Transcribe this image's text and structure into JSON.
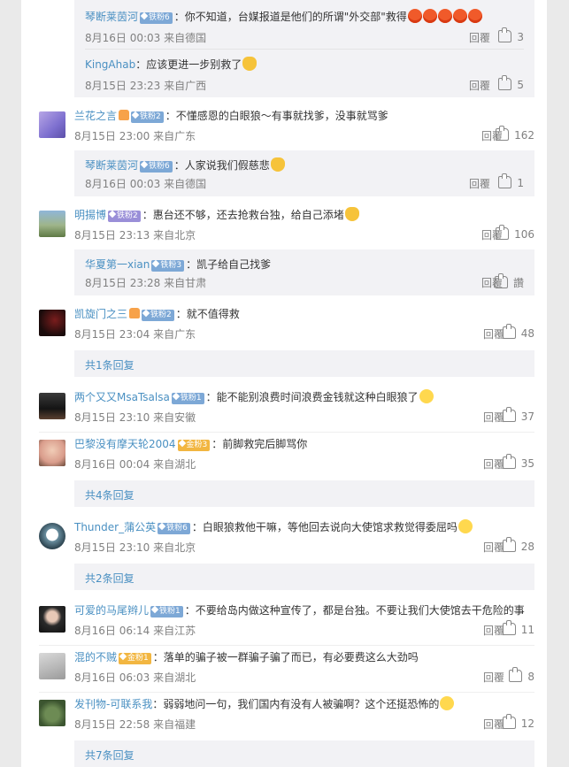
{
  "ui": {
    "reply": "回覆",
    "reply_simple": "回复"
  },
  "c0": {
    "replies": [
      {
        "user": "琴断莱茵河",
        "badge": "铁粉6",
        "text": "：你不知道，台媒报道是他们的所谓\"外交部\"救得",
        "emoji": "angry",
        "meta": "8月16日 00:03 来自德国",
        "reply": "回覆",
        "likes": "3"
      },
      {
        "user": "KingAhab",
        "badge": "",
        "text": "：应该更进一步别救了",
        "emoji": "cat",
        "meta": "8月15日 23:23 来自广西",
        "reply": "回覆",
        "likes": "5"
      }
    ]
  },
  "c1": {
    "user": "兰花之言",
    "badge": "铁粉2",
    "text": "：不懂感恩的白眼狼～有事就找爹，没事就骂爹",
    "meta": "8月15日 23:00 来自广东",
    "reply": "回覆",
    "likes": "162",
    "replies": [
      {
        "user": "琴断莱茵河",
        "badge": "铁粉6",
        "text": "：人家说我们假慈悲",
        "emoji": "cat",
        "meta": "8月16日 00:03 来自德国",
        "reply": "回覆",
        "likes": "1"
      }
    ]
  },
  "c2": {
    "user": "明揚博",
    "badge": "铁粉2",
    "text": "：惠台还不够，还去抢救台独，给自己添堵",
    "meta": "8月15日 23:13 来自北京",
    "reply": "回覆",
    "likes": "106",
    "replies": [
      {
        "user": "华夏第一xian",
        "badge": "铁粉3",
        "text": "：凯子给自己找爹",
        "meta": "8月15日 23:28 来自甘肃",
        "reply": "回覆",
        "likes": "讚"
      }
    ]
  },
  "c3": {
    "user": "凯旋门之三",
    "badge": "铁粉2",
    "text": "：就不值得救",
    "meta": "8月15日 23:04 来自广东",
    "reply": "回覆",
    "likes": "48",
    "more": "共1条回复"
  },
  "c4": {
    "user": "两个又又MsaTsalsa",
    "badge": "铁粉1",
    "text": "：能不能别浪费时间浪费金钱就这种白眼狼了",
    "meta": "8月15日 23:10 来自安徽",
    "reply": "回覆",
    "likes": "37"
  },
  "c5": {
    "user": "巴黎没有摩天轮2004",
    "badge": "金粉3",
    "text": "：前脚救完后脚骂你",
    "meta": "8月16日 00:04 来自湖北",
    "reply": "回覆",
    "likes": "35",
    "more": "共4条回复"
  },
  "c6": {
    "user": "Thunder_蒲公英",
    "badge": "铁粉6",
    "text": "：白眼狼救他干嘛，等他回去说向大使馆求救觉得委屈吗",
    "meta": "8月15日 23:10 来自北京",
    "reply": "回覆",
    "likes": "28",
    "more": "共2条回复"
  },
  "c7": {
    "user": "可爱的马尾辫儿",
    "badge": "铁粉1",
    "text": "：不要给岛内做这种宣传了，都是台独。不要让我们大使馆去干危险的事",
    "meta": "8月16日 06:14 来自江苏",
    "reply": "回覆",
    "likes": "11"
  },
  "c8": {
    "user": "混的不贼",
    "badge": "金粉1",
    "text": "：落单的骗子被一群骗子骗了而已，有必要费这么大劲吗",
    "meta": "8月16日 06:03 来自湖北",
    "reply": "回覆",
    "likes": "8"
  },
  "c9": {
    "user": "发刊物-可联系我",
    "badge": "",
    "text": "：弱弱地问一句，我们国内有没有人被骗啊？这个还挺恐怖的",
    "meta": "8月15日 22:58 来自福建",
    "reply": "回覆",
    "likes": "12",
    "more": "共7条回复"
  },
  "colors": {
    "accent": "#eb7350",
    "link": "#4a90c2",
    "muted": "#808080"
  },
  "icons": [
    "thumb-up-icon",
    "diamond-icon",
    "crown-icon",
    "emoji-angry-icon",
    "emoji-cat-icon",
    "emoji-smile-icon"
  ]
}
